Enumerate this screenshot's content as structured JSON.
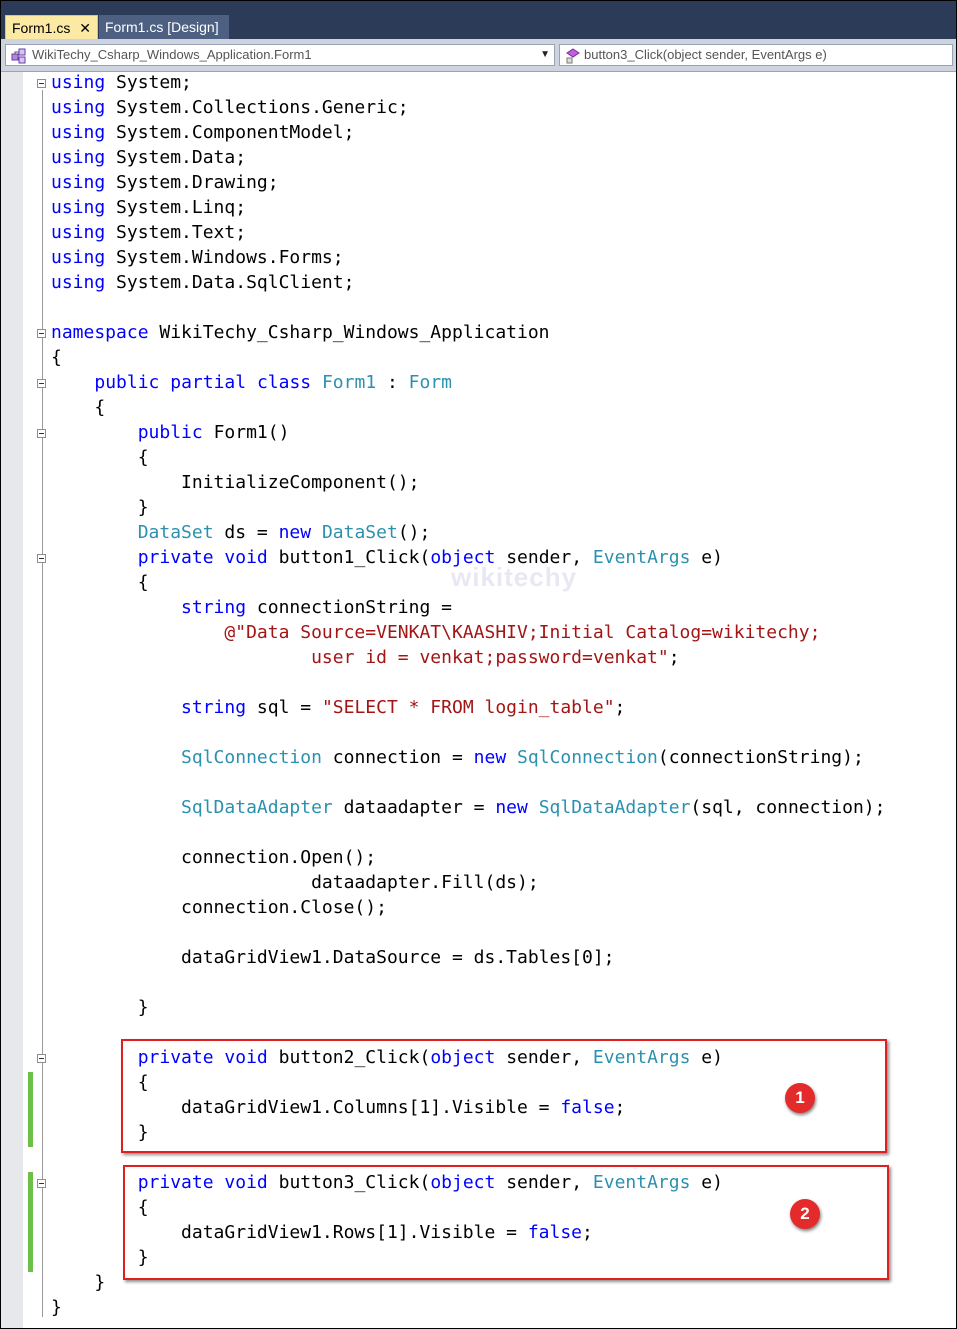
{
  "tabs": [
    {
      "label": "Form1.cs",
      "close_glyph": "✕",
      "active": true
    },
    {
      "label": "Form1.cs [Design]",
      "active": false
    }
  ],
  "navbar": {
    "class_combo": {
      "value": "WikiTechy_Csharp_Windows_Application.Form1",
      "icon": "class-icon"
    },
    "member_combo": {
      "value": "button3_Click(object sender, EventArgs e)",
      "icon": "method-icon"
    }
  },
  "watermark": "wikitechy",
  "colors": {
    "keyword": "#0000ff",
    "type": "#2b91af",
    "string": "#a31515",
    "highlight": "#e02020",
    "modified": "#6cc04a"
  },
  "badges": [
    "1",
    "2"
  ],
  "code_lines": [
    [
      {
        "t": "using",
        "c": "kw"
      },
      {
        "t": " System;"
      }
    ],
    [
      {
        "t": "using",
        "c": "kw"
      },
      {
        "t": " System.Collections.Generic;"
      }
    ],
    [
      {
        "t": "using",
        "c": "kw"
      },
      {
        "t": " System.ComponentModel;"
      }
    ],
    [
      {
        "t": "using",
        "c": "kw"
      },
      {
        "t": " System.Data;"
      }
    ],
    [
      {
        "t": "using",
        "c": "kw"
      },
      {
        "t": " System.Drawing;"
      }
    ],
    [
      {
        "t": "using",
        "c": "kw"
      },
      {
        "t": " System.Linq;"
      }
    ],
    [
      {
        "t": "using",
        "c": "kw"
      },
      {
        "t": " System.Text;"
      }
    ],
    [
      {
        "t": "using",
        "c": "kw"
      },
      {
        "t": " System.Windows.Forms;"
      }
    ],
    [
      {
        "t": "using",
        "c": "kw"
      },
      {
        "t": " System.Data.SqlClient;"
      }
    ],
    [],
    [
      {
        "t": "namespace",
        "c": "kw"
      },
      {
        "t": " WikiTechy_Csharp_Windows_Application"
      }
    ],
    [
      {
        "t": "{"
      }
    ],
    [
      {
        "t": "    "
      },
      {
        "t": "public",
        "c": "kw"
      },
      {
        "t": " "
      },
      {
        "t": "partial",
        "c": "kw"
      },
      {
        "t": " "
      },
      {
        "t": "class",
        "c": "kw"
      },
      {
        "t": " "
      },
      {
        "t": "Form1",
        "c": "ty"
      },
      {
        "t": " : "
      },
      {
        "t": "Form",
        "c": "ty"
      }
    ],
    [
      {
        "t": "    {"
      }
    ],
    [
      {
        "t": "        "
      },
      {
        "t": "public",
        "c": "kw"
      },
      {
        "t": " Form1()"
      }
    ],
    [
      {
        "t": "        {"
      }
    ],
    [
      {
        "t": "            InitializeComponent();"
      }
    ],
    [
      {
        "t": "        }"
      }
    ],
    [
      {
        "t": "        "
      },
      {
        "t": "DataSet",
        "c": "ty"
      },
      {
        "t": " ds = "
      },
      {
        "t": "new",
        "c": "kw"
      },
      {
        "t": " "
      },
      {
        "t": "DataSet",
        "c": "ty"
      },
      {
        "t": "();"
      }
    ],
    [
      {
        "t": "        "
      },
      {
        "t": "private",
        "c": "kw"
      },
      {
        "t": " "
      },
      {
        "t": "void",
        "c": "kw"
      },
      {
        "t": " button1_Click("
      },
      {
        "t": "object",
        "c": "kw"
      },
      {
        "t": " sender, "
      },
      {
        "t": "EventArgs",
        "c": "ty"
      },
      {
        "t": " e)"
      }
    ],
    [
      {
        "t": "        {"
      }
    ],
    [
      {
        "t": "            "
      },
      {
        "t": "string",
        "c": "kw"
      },
      {
        "t": " connectionString ="
      }
    ],
    [
      {
        "t": "                "
      },
      {
        "t": "@\"Data Source=VENKAT\\KAASHIV;Initial Catalog=wikitechy;",
        "c": "str"
      }
    ],
    [
      {
        "t": "                        "
      },
      {
        "t": "user id = venkat;password=venkat\"",
        "c": "str"
      },
      {
        "t": ";"
      }
    ],
    [],
    [
      {
        "t": "            "
      },
      {
        "t": "string",
        "c": "kw"
      },
      {
        "t": " sql = "
      },
      {
        "t": "\"SELECT * FROM login_table\"",
        "c": "str"
      },
      {
        "t": ";"
      }
    ],
    [],
    [
      {
        "t": "            "
      },
      {
        "t": "SqlConnection",
        "c": "ty"
      },
      {
        "t": " connection = "
      },
      {
        "t": "new",
        "c": "kw"
      },
      {
        "t": " "
      },
      {
        "t": "SqlConnection",
        "c": "ty"
      },
      {
        "t": "(connectionString);"
      }
    ],
    [],
    [
      {
        "t": "            "
      },
      {
        "t": "SqlDataAdapter",
        "c": "ty"
      },
      {
        "t": " dataadapter = "
      },
      {
        "t": "new",
        "c": "kw"
      },
      {
        "t": " "
      },
      {
        "t": "SqlDataAdapter",
        "c": "ty"
      },
      {
        "t": "(sql, connection);"
      }
    ],
    [],
    [
      {
        "t": "            connection.Open();"
      }
    ],
    [
      {
        "t": "                        dataadapter.Fill(ds);"
      }
    ],
    [
      {
        "t": "            connection.Close();"
      }
    ],
    [],
    [
      {
        "t": "            dataGridView1.DataSource = ds.Tables[0];"
      }
    ],
    [],
    [
      {
        "t": "        }"
      }
    ],
    [],
    [
      {
        "t": "        "
      },
      {
        "t": "private",
        "c": "kw"
      },
      {
        "t": " "
      },
      {
        "t": "void",
        "c": "kw"
      },
      {
        "t": " button2_Click("
      },
      {
        "t": "object",
        "c": "kw"
      },
      {
        "t": " sender, "
      },
      {
        "t": "EventArgs",
        "c": "ty"
      },
      {
        "t": " e)"
      }
    ],
    [
      {
        "t": "        {"
      }
    ],
    [
      {
        "t": "            dataGridView1.Columns[1].Visible = "
      },
      {
        "t": "false",
        "c": "kw"
      },
      {
        "t": ";"
      }
    ],
    [
      {
        "t": "        }"
      }
    ],
    [],
    [
      {
        "t": "        "
      },
      {
        "t": "private",
        "c": "kw"
      },
      {
        "t": " "
      },
      {
        "t": "void",
        "c": "kw"
      },
      {
        "t": " button3_Click("
      },
      {
        "t": "object",
        "c": "kw"
      },
      {
        "t": " sender, "
      },
      {
        "t": "EventArgs",
        "c": "ty"
      },
      {
        "t": " e)"
      }
    ],
    [
      {
        "t": "        {"
      }
    ],
    [
      {
        "t": "            dataGridView1.Rows[1].Visible = "
      },
      {
        "t": "false",
        "c": "kw"
      },
      {
        "t": ";"
      }
    ],
    [
      {
        "t": "        }"
      }
    ],
    [
      {
        "t": "    }"
      }
    ],
    [
      {
        "t": "}"
      }
    ]
  ]
}
